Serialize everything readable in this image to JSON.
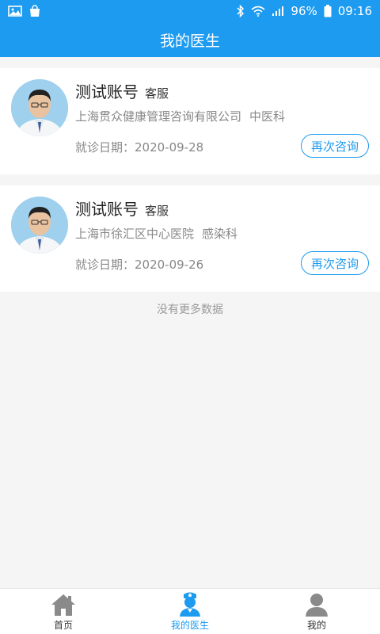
{
  "status_bar": {
    "battery": "96%",
    "time": "09:16"
  },
  "header": {
    "title": "我的医生"
  },
  "doctors": [
    {
      "name": "测试账号",
      "title": "客服",
      "hospital": "上海贯众健康管理咨询有限公司",
      "department": "中医科",
      "visit_date": "就诊日期：2020-09-28",
      "button_label": "再次咨询"
    },
    {
      "name": "测试账号",
      "title": "客服",
      "hospital": "上海市徐汇区中心医院",
      "department": "感染科",
      "visit_date": "就诊日期：2020-09-26",
      "button_label": "再次咨询"
    }
  ],
  "list_footer": "没有更多数据",
  "tabs": [
    {
      "label": "首页",
      "icon": "home-icon",
      "active": false
    },
    {
      "label": "我的医生",
      "icon": "doctor-icon",
      "active": true
    },
    {
      "label": "我的",
      "icon": "user-icon",
      "active": false
    }
  ],
  "colors": {
    "primary": "#1d9bf0",
    "tab_inactive_icon": "#8a8a8a"
  }
}
